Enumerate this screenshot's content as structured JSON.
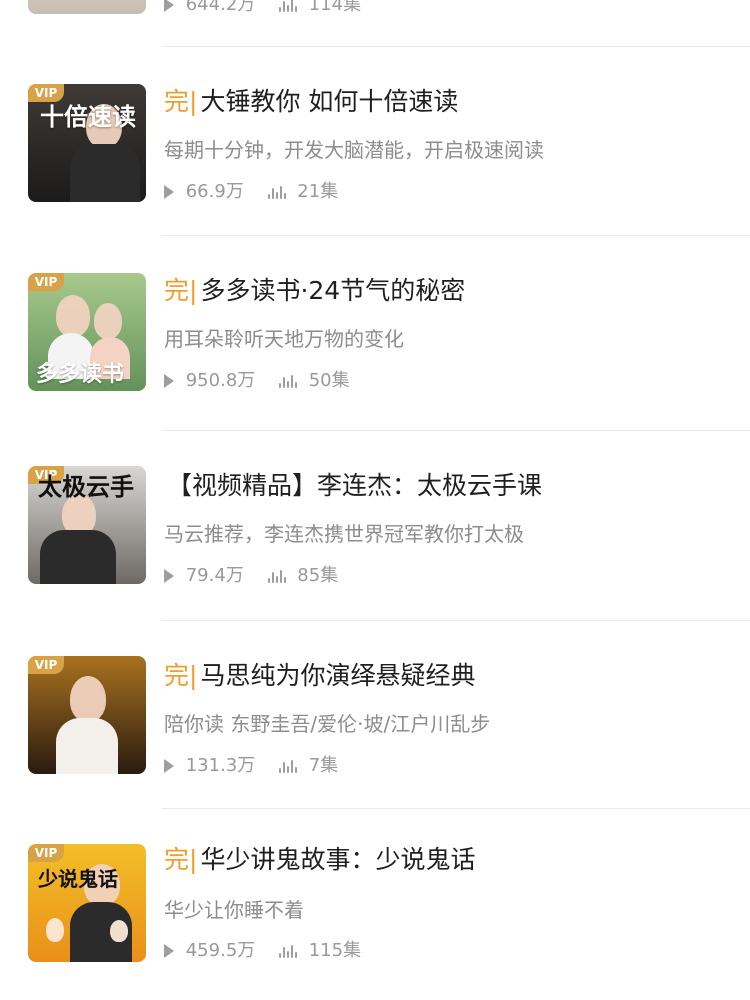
{
  "colors": {
    "accent": "#ef9e2b",
    "vip": "#d9a247",
    "title": "#1f1f1f",
    "meta": "#9a9a9a",
    "divider": "#e9e9e9"
  },
  "partial_top_item": {
    "plays": "644.2万",
    "episodes": "114集"
  },
  "items": [
    {
      "vip": "VIP",
      "status": "完|",
      "title": "大锤教你 如何十倍速读",
      "subtitle": "每期十分钟，开发大脑潜能，开启极速阅读",
      "plays": "66.9万",
      "episodes": "21集",
      "cover_text": "十倍速读"
    },
    {
      "vip": "VIP",
      "status": "完|",
      "title": "多多读书·24节气的秘密",
      "subtitle": "用耳朵聆听天地万物的变化",
      "plays": "950.8万",
      "episodes": "50集",
      "cover_text": "多多读书"
    },
    {
      "vip": "VIP",
      "status": "",
      "title": "【视频精品】李连杰：太极云手课",
      "subtitle": "马云推荐，李连杰携世界冠军教你打太极",
      "plays": "79.4万",
      "episodes": "85集",
      "cover_text": "太极云手"
    },
    {
      "vip": "VIP",
      "status": "完|",
      "title": "马思纯为你演绎悬疑经典",
      "subtitle": "陪你读 东野圭吾/爱伦·坡/江户川乱步",
      "plays": "131.3万",
      "episodes": "7集",
      "cover_text": ""
    },
    {
      "vip": "VIP",
      "status": "完|",
      "title": "华少讲鬼故事：少说鬼话",
      "subtitle": "华少让你睡不着",
      "plays": "459.5万",
      "episodes": "115集",
      "cover_text": "少说鬼话"
    }
  ],
  "icons": {
    "play": "play-icon",
    "episodes": "episode-wave-icon"
  }
}
